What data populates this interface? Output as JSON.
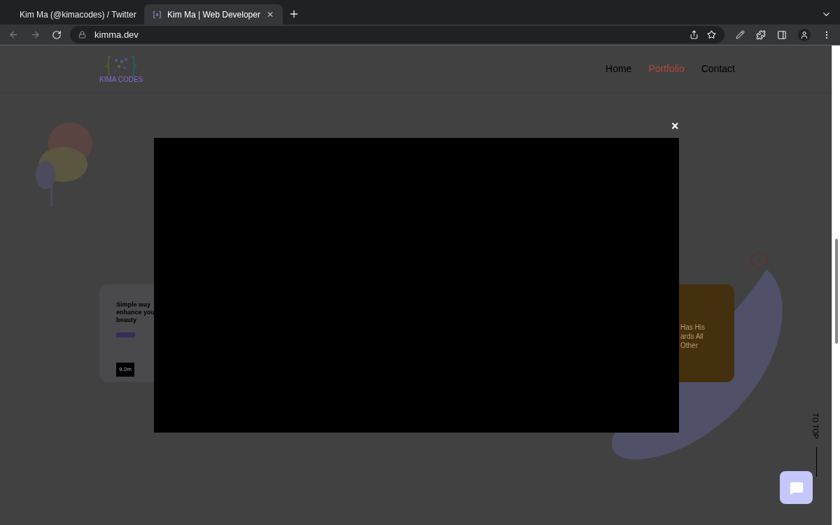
{
  "browser": {
    "tabs": [
      {
        "title": "Kim Ma (@kimacodes) / Twitter",
        "selected": false
      },
      {
        "title": "Kim Ma | Web Developer",
        "selected": true
      }
    ],
    "url": "kimma.dev"
  },
  "site": {
    "logo_text": "KIMA CODES",
    "nav": [
      {
        "label": "Home",
        "selected": false
      },
      {
        "label": "Portfolio",
        "selected": true
      },
      {
        "label": "Contact",
        "selected": false
      }
    ],
    "cards": [
      {
        "kind": "preview",
        "lines": [
          "Simple way",
          "enhance you",
          "beauty"
        ],
        "stat": "9.2m"
      },
      {
        "kind": "text",
        "lines": [
          "Has His",
          "ards All",
          "Other"
        ]
      }
    ],
    "to_top": "TO TOP"
  },
  "modal": {
    "close": "×"
  }
}
